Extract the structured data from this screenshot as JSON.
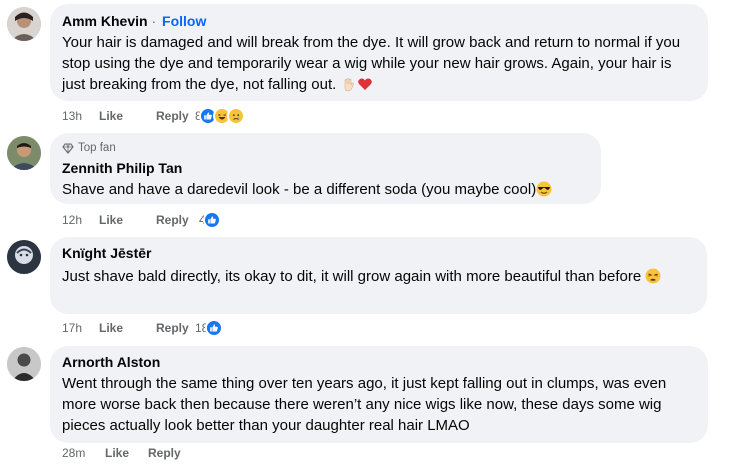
{
  "comments": [
    {
      "name": "Amm Khevin",
      "follow_separator": "·",
      "follow_label": "Follow",
      "badge": "",
      "text": "Your hair is damaged and will break from the dye. It will grow back and return to normal if you stop using the dye and temporarily wear a wig while your new hair grows. Again, your hair is just breaking from the dye, not falling out.",
      "time": "13h",
      "like_label": "Like",
      "reply_label": "Reply",
      "reaction_count": "8",
      "reactions": [
        "like",
        "haha",
        "sad"
      ]
    },
    {
      "name": "Zennith Philip Tan",
      "badge": "Top fan",
      "text": "Shave and have a daredevil look - be a different soda (you maybe cool)",
      "time": "12h",
      "like_label": "Like",
      "reply_label": "Reply",
      "reaction_count": "4",
      "reactions": [
        "like"
      ]
    },
    {
      "name": "Knïght Jēstēr",
      "badge": "",
      "text": "Just shave bald directly, its okay to dit, it will grow again with more beautiful than before",
      "time": "17h",
      "like_label": "Like",
      "reply_label": "Reply",
      "reaction_count": "18",
      "reactions": [
        "like"
      ]
    },
    {
      "name": "Arnorth Alston",
      "badge": "",
      "text": "Went through the same thing over ten years ago, it just kept falling out in clumps, was even more worse back then because there weren’t any nice wigs like now, these days some wig pieces actually look better than your daughter real hair LMAO",
      "time": "28m",
      "like_label": "Like",
      "reply_label": "Reply",
      "reaction_count": "",
      "reactions": []
    }
  ],
  "colors": {
    "bubble": "#f0f2f5",
    "meta_text": "#65676b",
    "follow": "#0866ff",
    "like_blue": "#1877f2"
  }
}
